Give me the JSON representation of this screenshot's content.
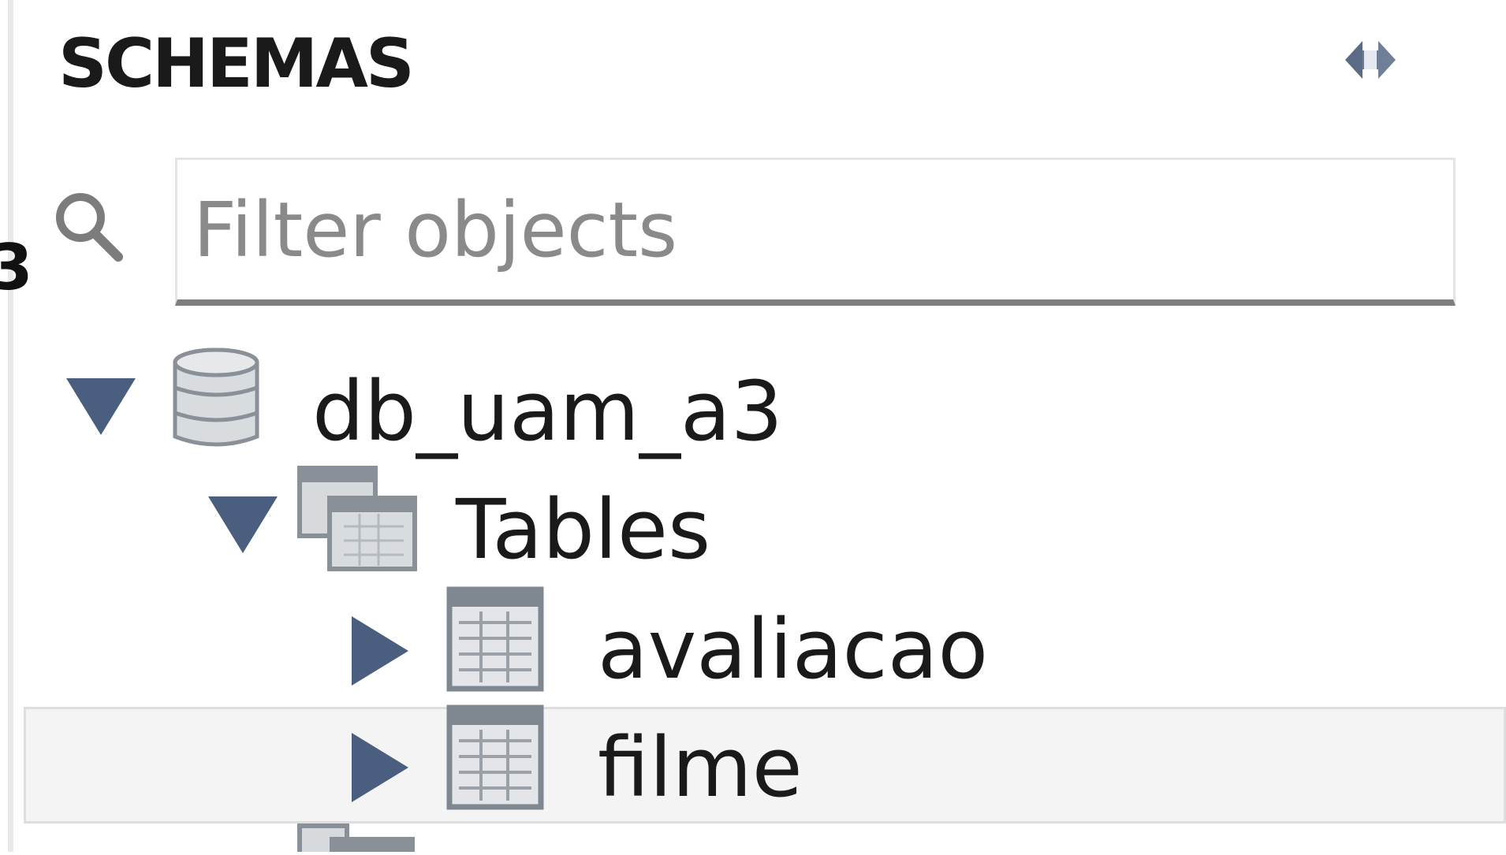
{
  "panel": {
    "title": "SCHEMAS",
    "edge_fragment": "3"
  },
  "toolbar": {
    "refresh_icon": "refresh-icon"
  },
  "filter": {
    "placeholder": "Filter objects",
    "value": "",
    "icon": "search-icon"
  },
  "tree": {
    "schema": {
      "label": "db_uam_a3",
      "icon": "database-icon",
      "expanded": true
    },
    "tables_group": {
      "label": "Tables",
      "icon": "tables-icon",
      "expanded": true
    },
    "tables": [
      {
        "label": "avaliacao",
        "icon": "table-icon",
        "expanded": false,
        "selected": false
      },
      {
        "label": "filme",
        "icon": "table-icon",
        "expanded": false,
        "selected": true
      }
    ],
    "next_group_icon": "views-icon"
  },
  "colors": {
    "arrow": "#4a5f80",
    "icon_gray": "#8c96a3",
    "selection_bg": "#f4f4f4",
    "filter_underline": "#7e7e7e"
  }
}
